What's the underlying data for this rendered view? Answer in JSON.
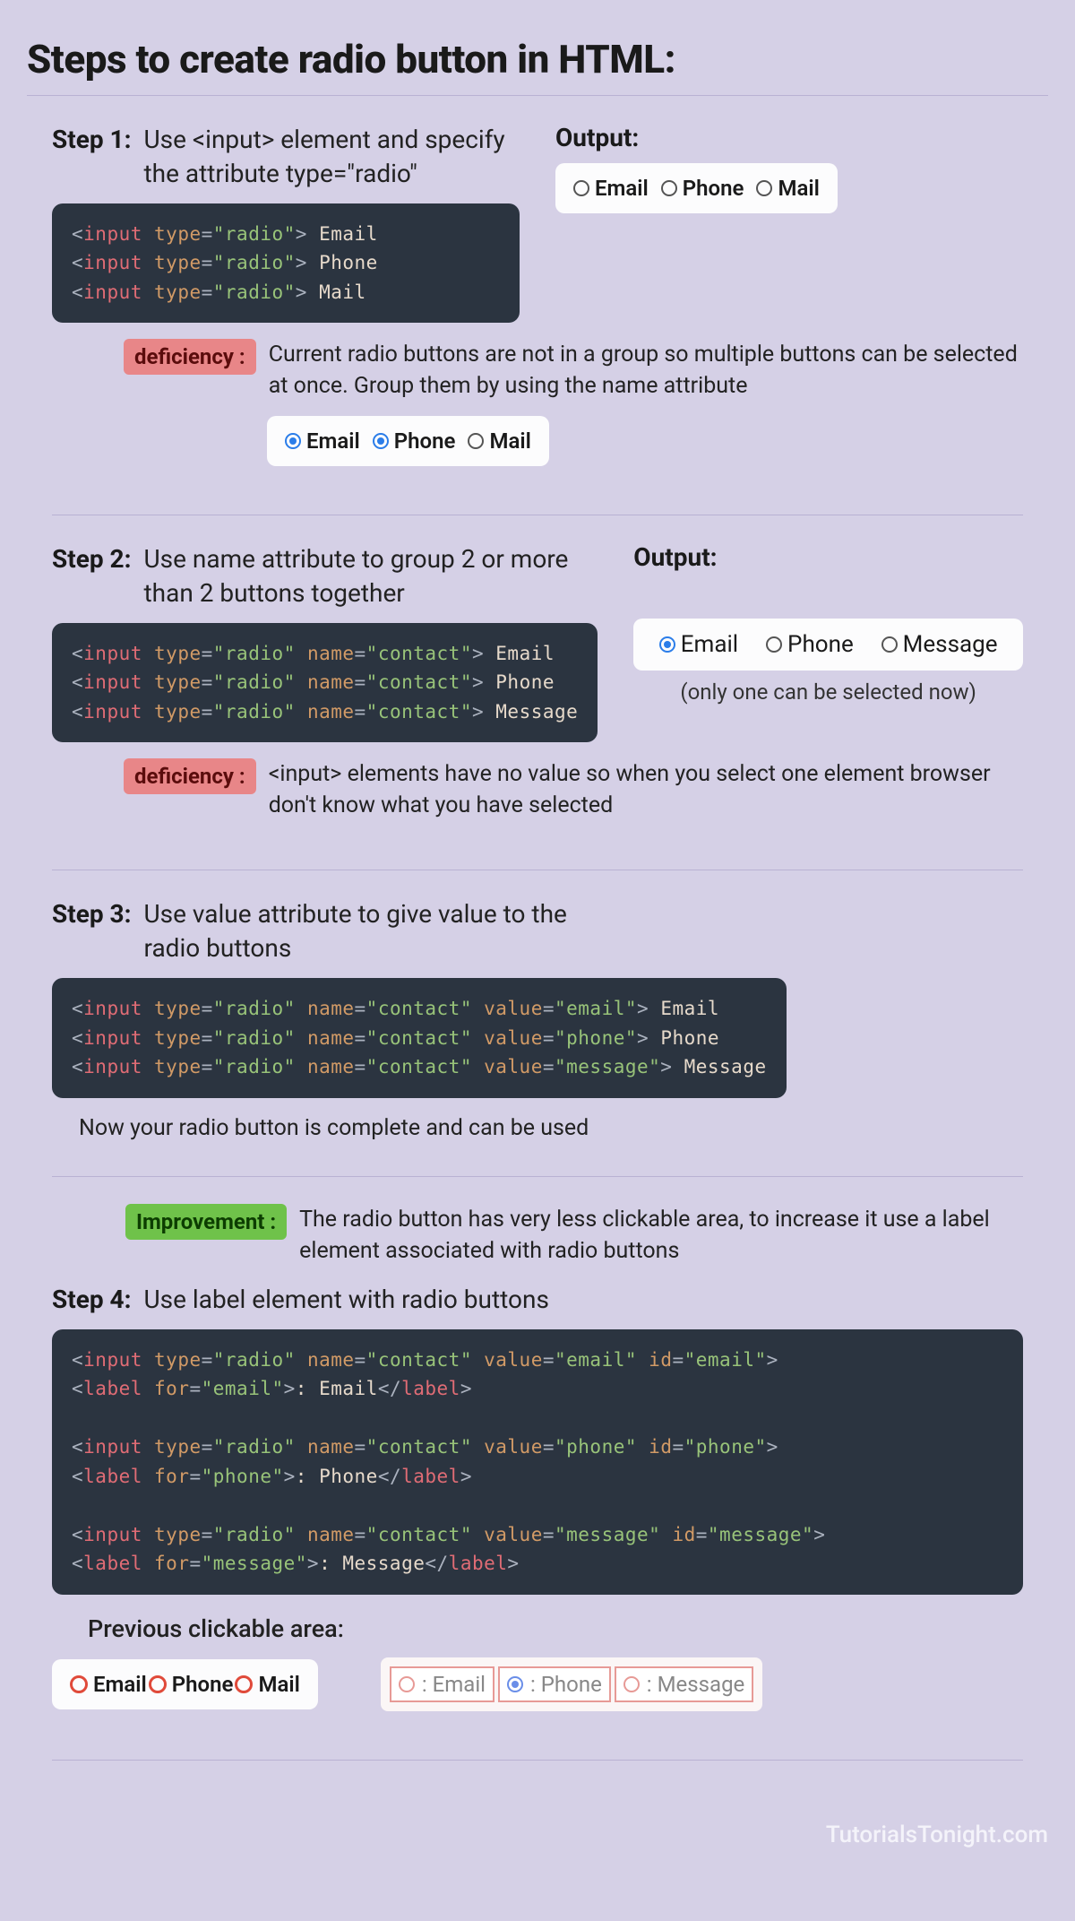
{
  "title": "Steps to create radio button in HTML:",
  "footer": "TutorialsTonight.com",
  "outputLabel": "Output:",
  "deficiencyLabel": "deficiency :",
  "improvementLabel": "Improvement :",
  "step1": {
    "label": "Step 1:",
    "desc": "Use <input> element and specify the attribute type=\"radio\"",
    "codeHtml": "<span class='tok-punc'>&lt;</span><span class='tok-tag'>input</span> <span class='tok-attr'>type</span><span class='tok-punc'>=</span><span class='tok-str'>\"radio\"</span><span class='tok-punc'>&gt;</span> <span class='tok-txt'>Email</span>\n<span class='tok-punc'>&lt;</span><span class='tok-tag'>input</span> <span class='tok-attr'>type</span><span class='tok-punc'>=</span><span class='tok-str'>\"radio\"</span><span class='tok-punc'>&gt;</span> <span class='tok-txt'>Phone</span>\n<span class='tok-punc'>&lt;</span><span class='tok-tag'>input</span> <span class='tok-attr'>type</span><span class='tok-punc'>=</span><span class='tok-str'>\"radio\"</span><span class='tok-punc'>&gt;</span> <span class='tok-txt'>Mail</span>",
    "outputs": [
      "Email",
      "Phone",
      "Mail"
    ],
    "deficiency": "Current radio buttons are not in a group so multiple buttons can be selected at once. Group them by using the name attribute",
    "demo2": [
      "Email",
      "Phone",
      "Mail"
    ]
  },
  "step2": {
    "label": "Step 2:",
    "desc": "Use name attribute to group 2 or more than 2 buttons together",
    "codeHtml": "<span class='tok-punc'>&lt;</span><span class='tok-tag'>input</span> <span class='tok-attr'>type</span><span class='tok-punc'>=</span><span class='tok-str'>\"radio\"</span> <span class='tok-attr'>name</span><span class='tok-punc'>=</span><span class='tok-str'>\"contact\"</span><span class='tok-punc'>&gt;</span> <span class='tok-txt'>Email</span>\n<span class='tok-punc'>&lt;</span><span class='tok-tag'>input</span> <span class='tok-attr'>type</span><span class='tok-punc'>=</span><span class='tok-str'>\"radio\"</span> <span class='tok-attr'>name</span><span class='tok-punc'>=</span><span class='tok-str'>\"contact\"</span><span class='tok-punc'>&gt;</span> <span class='tok-txt'>Phone</span>\n<span class='tok-punc'>&lt;</span><span class='tok-tag'>input</span> <span class='tok-attr'>type</span><span class='tok-punc'>=</span><span class='tok-str'>\"radio\"</span> <span class='tok-attr'>name</span><span class='tok-punc'>=</span><span class='tok-str'>\"contact\"</span><span class='tok-punc'>&gt;</span> <span class='tok-txt'>Message</span>",
    "outputs": [
      "Email",
      "Phone",
      "Message"
    ],
    "note": "(only one can be selected now)",
    "deficiency": "<input> elements have no value so when you select one element browser don't know what you have selected"
  },
  "step3": {
    "label": "Step 3:",
    "desc": "Use value attribute to give value to the radio buttons",
    "codeHtml": "<span class='tok-punc'>&lt;</span><span class='tok-tag'>input</span> <span class='tok-attr'>type</span><span class='tok-punc'>=</span><span class='tok-str'>\"radio\"</span> <span class='tok-attr'>name</span><span class='tok-punc'>=</span><span class='tok-str'>\"contact\"</span> <span class='tok-attr'>value</span><span class='tok-punc'>=</span><span class='tok-str'>\"email\"</span><span class='tok-punc'>&gt;</span> <span class='tok-txt'>Email</span>\n<span class='tok-punc'>&lt;</span><span class='tok-tag'>input</span> <span class='tok-attr'>type</span><span class='tok-punc'>=</span><span class='tok-str'>\"radio\"</span> <span class='tok-attr'>name</span><span class='tok-punc'>=</span><span class='tok-str'>\"contact\"</span> <span class='tok-attr'>value</span><span class='tok-punc'>=</span><span class='tok-str'>\"phone\"</span><span class='tok-punc'>&gt;</span> <span class='tok-txt'>Phone</span>\n<span class='tok-punc'>&lt;</span><span class='tok-tag'>input</span> <span class='tok-attr'>type</span><span class='tok-punc'>=</span><span class='tok-str'>\"radio\"</span> <span class='tok-attr'>name</span><span class='tok-punc'>=</span><span class='tok-str'>\"contact\"</span> <span class='tok-attr'>value</span><span class='tok-punc'>=</span><span class='tok-str'>\"message\"</span><span class='tok-punc'>&gt;</span> <span class='tok-txt'>Message</span>",
    "after": "Now your radio button is complete and can be used",
    "improvement": "The radio button has very less clickable area, to increase it use a label element associated with radio buttons"
  },
  "step4": {
    "label": "Step 4:",
    "desc": "Use label element with radio buttons",
    "codeHtml": "<span class='tok-punc'>&lt;</span><span class='tok-tag'>input</span> <span class='tok-attr'>type</span><span class='tok-punc'>=</span><span class='tok-str'>\"radio\"</span> <span class='tok-attr'>name</span><span class='tok-punc'>=</span><span class='tok-str'>\"contact\"</span> <span class='tok-attr'>value</span><span class='tok-punc'>=</span><span class='tok-str'>\"email\"</span> <span class='tok-attr'>id</span><span class='tok-punc'>=</span><span class='tok-str'>\"email\"</span><span class='tok-punc'>&gt;</span>\n<span class='tok-punc'>&lt;</span><span class='tok-tag'>label</span> <span class='tok-attr'>for</span><span class='tok-punc'>=</span><span class='tok-str'>\"email\"</span><span class='tok-punc'>&gt;</span><span class='tok-txt'>: Email</span><span class='tok-punc'>&lt;/</span><span class='tok-tag'>label</span><span class='tok-punc'>&gt;</span>\n\n<span class='tok-punc'>&lt;</span><span class='tok-tag'>input</span> <span class='tok-attr'>type</span><span class='tok-punc'>=</span><span class='tok-str'>\"radio\"</span> <span class='tok-attr'>name</span><span class='tok-punc'>=</span><span class='tok-str'>\"contact\"</span> <span class='tok-attr'>value</span><span class='tok-punc'>=</span><span class='tok-str'>\"phone\"</span> <span class='tok-attr'>id</span><span class='tok-punc'>=</span><span class='tok-str'>\"phone\"</span><span class='tok-punc'>&gt;</span>\n<span class='tok-punc'>&lt;</span><span class='tok-tag'>label</span> <span class='tok-attr'>for</span><span class='tok-punc'>=</span><span class='tok-str'>\"phone\"</span><span class='tok-punc'>&gt;</span><span class='tok-txt'>: Phone</span><span class='tok-punc'>&lt;/</span><span class='tok-tag'>label</span><span class='tok-punc'>&gt;</span>\n\n<span class='tok-punc'>&lt;</span><span class='tok-tag'>input</span> <span class='tok-attr'>type</span><span class='tok-punc'>=</span><span class='tok-str'>\"radio\"</span> <span class='tok-attr'>name</span><span class='tok-punc'>=</span><span class='tok-str'>\"contact\"</span> <span class='tok-attr'>value</span><span class='tok-punc'>=</span><span class='tok-str'>\"message\"</span> <span class='tok-attr'>id</span><span class='tok-punc'>=</span><span class='tok-str'>\"message\"</span><span class='tok-punc'>&gt;</span>\n<span class='tok-punc'>&lt;</span><span class='tok-tag'>label</span> <span class='tok-attr'>for</span><span class='tok-punc'>=</span><span class='tok-str'>\"message\"</span><span class='tok-punc'>&gt;</span><span class='tok-txt'>: Message</span><span class='tok-punc'>&lt;/</span><span class='tok-tag'>label</span><span class='tok-punc'>&gt;</span>",
    "prevLabel": "Previous clickable area:",
    "prev": [
      "Email",
      "Phone",
      "Mail"
    ],
    "new": [
      ": Email",
      ": Phone",
      ": Message"
    ]
  }
}
